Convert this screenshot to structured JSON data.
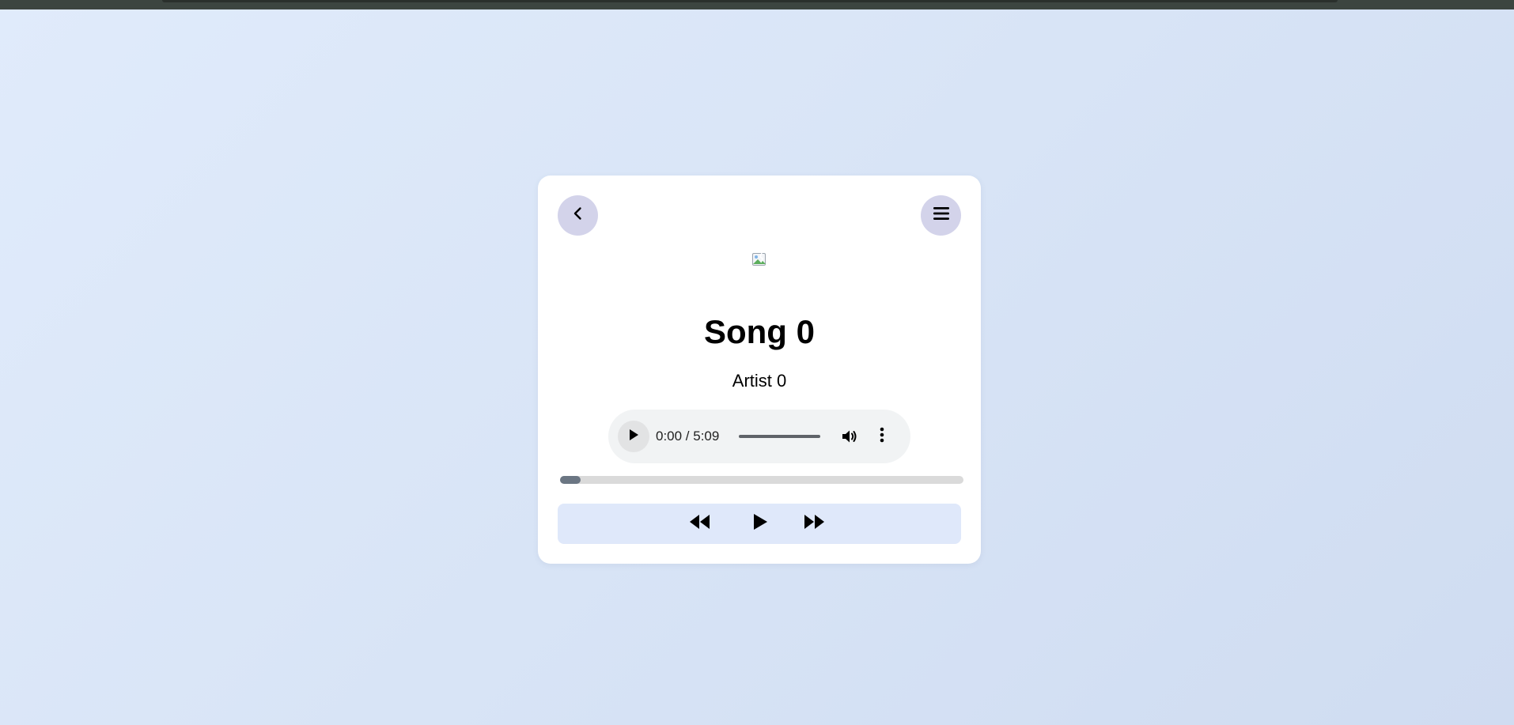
{
  "player": {
    "song_title": "Song 0",
    "artist": "Artist 0",
    "progress_fraction": 0.05,
    "audio": {
      "current_time": "0:00",
      "duration": "5:09",
      "time_display": "0:00 / 5:09"
    }
  },
  "icons": {
    "back": "chevron-left-icon",
    "menu": "hamburger-icon",
    "album_art": "broken-image-icon",
    "audio_play": "play-icon",
    "volume": "volume-icon",
    "more": "more-vertical-icon",
    "previous": "rewind-icon",
    "play": "play-icon",
    "next": "fast-forward-icon"
  },
  "colors": {
    "background": "#dbe6f7",
    "card": "#ffffff",
    "circle_button": "#d3d3ea",
    "controls_bar": "#dfe8fa",
    "progress_fill": "#6b7683",
    "progress_track": "#dadada"
  }
}
